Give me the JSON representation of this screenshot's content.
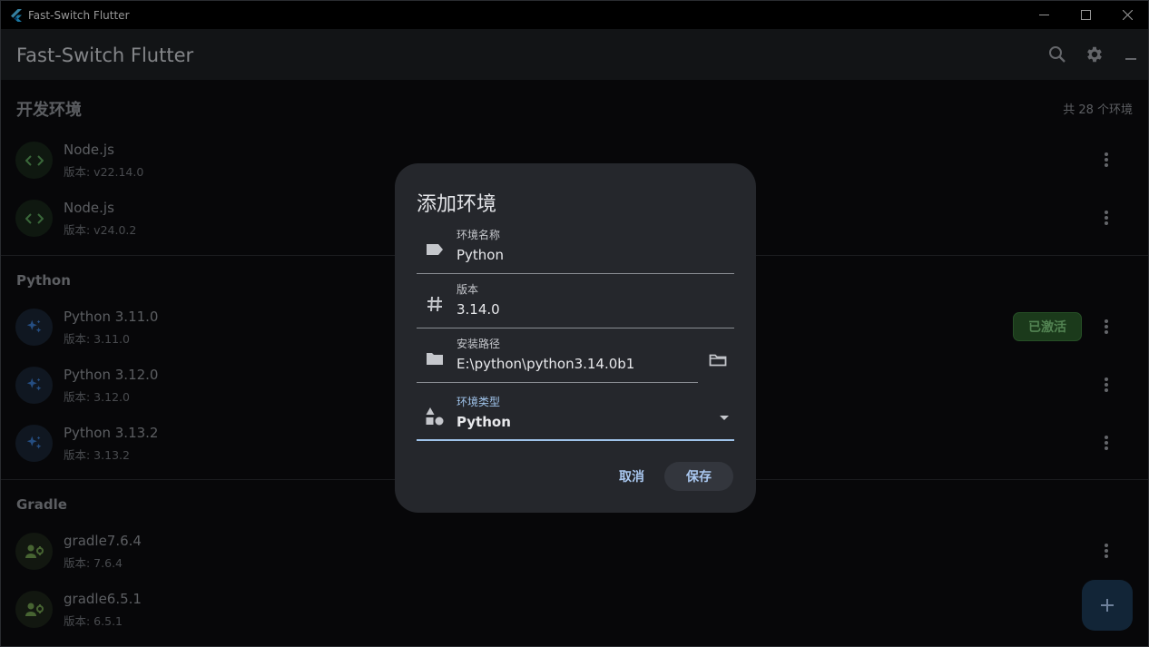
{
  "window": {
    "title": "Fast-Switch Flutter",
    "icon": "flutter-logo-icon",
    "controls": [
      "minimize-icon",
      "maximize-icon",
      "close-icon"
    ]
  },
  "appbar": {
    "title": "Fast-Switch Flutter",
    "actions": [
      "search-icon",
      "gear-icon",
      "minimize-icon"
    ]
  },
  "sections": [
    {
      "title": "开发环境",
      "count_text": "共 28 个环境",
      "items": [
        {
          "name": "Node.js",
          "version": "版本: v22.14.0",
          "icon": "code-icon"
        },
        {
          "name": "Node.js",
          "version": "版本: v24.0.2",
          "icon": "code-icon"
        }
      ]
    },
    {
      "title": "Python",
      "items": [
        {
          "name": "Python 3.11.0",
          "version": "版本: 3.11.0",
          "icon": "sparkle-icon",
          "badge": "已激活"
        },
        {
          "name": "Python 3.12.0",
          "version": "版本: 3.12.0",
          "icon": "sparkle-icon"
        },
        {
          "name": "Python 3.13.2",
          "version": "版本: 3.13.2",
          "icon": "sparkle-icon"
        }
      ]
    },
    {
      "title": "Gradle",
      "items": [
        {
          "name": "gradle7.6.4",
          "version": "版本: 7.6.4",
          "icon": "engineering-icon"
        },
        {
          "name": "gradle6.5.1",
          "version": "版本: 6.5.1",
          "icon": "engineering-icon"
        }
      ]
    }
  ],
  "dialog": {
    "title": "添加环境",
    "fields": {
      "name": {
        "label": "环境名称",
        "value": "Python",
        "icon": "label-icon"
      },
      "version": {
        "label": "版本",
        "value": "3.14.0",
        "icon": "hash-icon"
      },
      "path": {
        "label": "安装路径",
        "value": "E:\\python\\python3.14.0b1",
        "icon": "folder-icon"
      },
      "type": {
        "label": "环境类型",
        "value": "Python",
        "icon": "category-icon"
      }
    },
    "browse_icon": "folder-open-icon",
    "cancel_label": "取消",
    "save_label": "保存"
  },
  "fab_icon": "plus-icon",
  "colors": {
    "accent": "#9fc3ea",
    "badge_green": "#2a5a2a",
    "dialog_bg": "#25272c",
    "page_bg": "#0b0c0e"
  }
}
